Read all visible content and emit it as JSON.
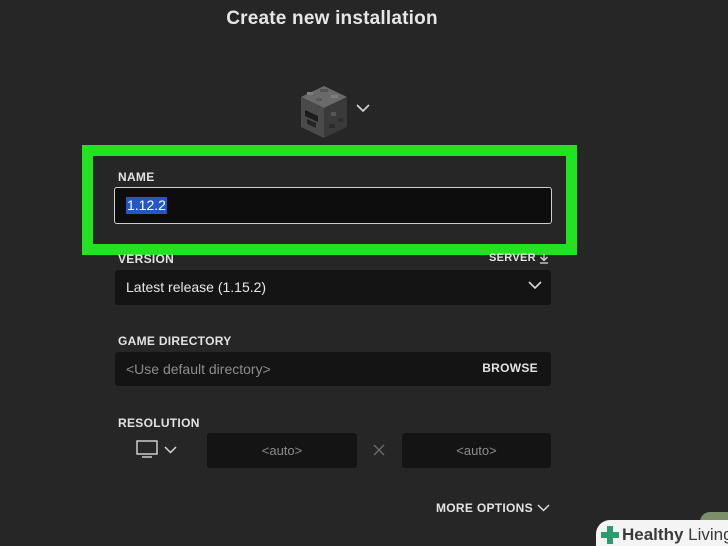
{
  "dialog": {
    "title": "Create new installation",
    "icon": "furnace-block-icon"
  },
  "name_field": {
    "label": "NAME",
    "value": "1.12.2"
  },
  "version_field": {
    "label": "VERSION",
    "server_link": "SERVER",
    "selected": "Latest release (1.15.2)"
  },
  "game_directory": {
    "label": "GAME DIRECTORY",
    "placeholder": "<Use default directory>",
    "browse_label": "BROWSE"
  },
  "resolution": {
    "label": "RESOLUTION",
    "width": "<auto>",
    "height": "<auto>",
    "separator_icon": "times-icon"
  },
  "more_options_label": "MORE OPTIONS",
  "watermark": {
    "brand_bold": "Healthy",
    "brand_rest": " Living"
  },
  "colors": {
    "background": "#262626",
    "highlight": "#22e322",
    "selection": "#2457c5"
  }
}
